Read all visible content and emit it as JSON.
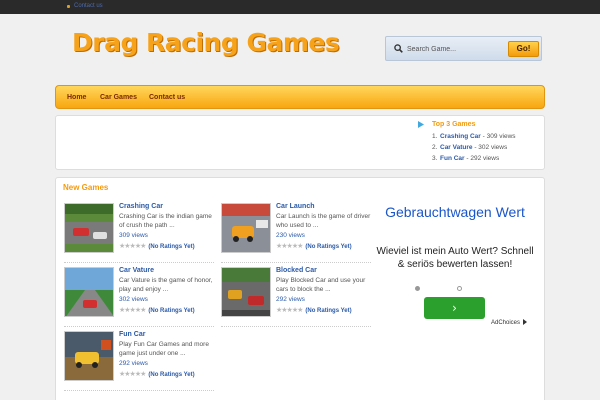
{
  "topbar": {
    "link": "Contact us"
  },
  "header": {
    "logo": "Drag Racing Games",
    "search": {
      "placeholder": "Search Game...",
      "button": "Go!"
    }
  },
  "nav": {
    "items": [
      "Home",
      "Car Games",
      "Contact us"
    ]
  },
  "top3": {
    "title": "Top 3 Games",
    "items": [
      {
        "num": "1.",
        "name": "Crashing Car",
        "views": " - 309 views"
      },
      {
        "num": "2.",
        "name": "Car Vature",
        "views": " - 302 views"
      },
      {
        "num": "3.",
        "name": "Fun Car",
        "views": " - 292 views"
      }
    ]
  },
  "new_games": {
    "title": "New Games",
    "items": [
      {
        "title": "Crashing Car",
        "desc": "Crashing Car is the indian game of crush the path ...",
        "views": "309 views",
        "rating": "(No Ratings Yet)"
      },
      {
        "title": "Car Launch",
        "desc": "Car Launch is the game of driver who used to ...",
        "views": "230 views",
        "rating": "(No Ratings Yet)"
      },
      {
        "title": "Car Vature",
        "desc": "Car Vature is the game of honor, play and enjoy ...",
        "views": "302 views",
        "rating": "(No Ratings Yet)"
      },
      {
        "title": "Blocked Car",
        "desc": "Play Blocked Car and use your cars to block the ...",
        "views": "292 views",
        "rating": "(No Ratings Yet)"
      },
      {
        "title": "Fun Car",
        "desc": "Play Fun Car Games and more game just under one ...",
        "views": "292 views",
        "rating": "(No Ratings Yet)"
      }
    ],
    "stars": "★★★★★"
  },
  "ad": {
    "headline": "Gebrauchtwagen Wert",
    "body": "Wieviel ist mein Auto Wert? Schnell & seriös bewerten lassen!",
    "button": "›",
    "adchoices": "AdChoices"
  },
  "colors": {
    "accent": "#f59b0d",
    "link": "#2b5aa8",
    "ad_button": "#2ca02c"
  }
}
